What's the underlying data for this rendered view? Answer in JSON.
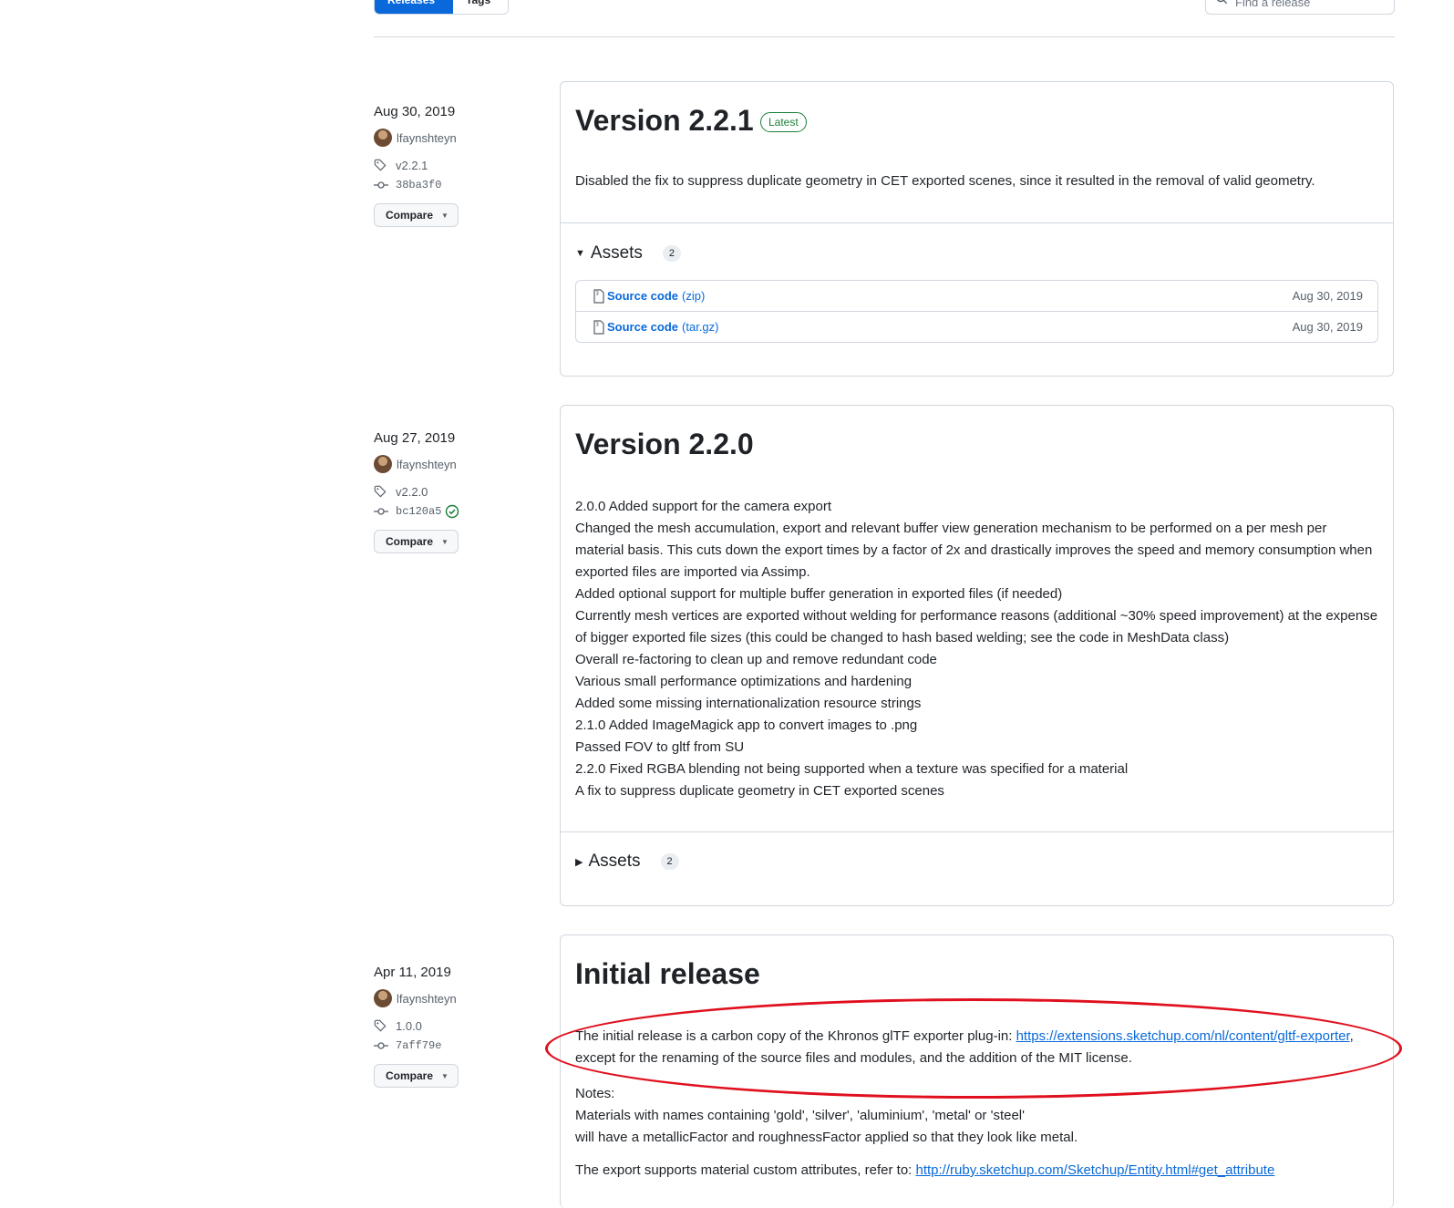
{
  "tabs": {
    "releases": "Releases",
    "tags": "Tags"
  },
  "search": {
    "placeholder": "Find a release"
  },
  "releases": [
    {
      "date": "Aug 30, 2019",
      "author": "lfaynshteyn",
      "tag": "v2.2.1",
      "commit": "38ba3f0",
      "compare_label": "Compare",
      "title": "Version 2.2.1",
      "badge": "Latest",
      "body": [
        "Disabled the fix to suppress duplicate geometry in CET exported scenes, since it resulted in the removal of valid geometry."
      ],
      "assets_label": "Assets",
      "assets_count": "2",
      "assets": [
        {
          "name": "Source code",
          "format": "(zip)",
          "date": "Aug 30, 2019"
        },
        {
          "name": "Source code",
          "format": "(tar.gz)",
          "date": "Aug 30, 2019"
        }
      ]
    },
    {
      "date": "Aug 27, 2019",
      "author": "lfaynshteyn",
      "tag": "v2.2.0",
      "commit": "bc120a5",
      "compare_label": "Compare",
      "title": "Version 2.2.0",
      "body": [
        "2.0.0 Added support for the camera export",
        "Changed the mesh accumulation, export and relevant buffer view generation mechanism to be performed on a per mesh per material basis. This cuts down the export times by a factor of 2x and drastically improves the speed and memory consumption when exported files are imported via Assimp.",
        "Added optional support for multiple buffer generation in exported files (if needed)",
        "Currently mesh vertices are exported without welding for performance reasons (additional ~30% speed improvement) at the expense of bigger exported file sizes (this could be changed to hash based welding; see the code in MeshData class)",
        "Overall re-factoring to clean up and remove redundant code",
        "Various small performance optimizations and hardening",
        "Added some missing internationalization resource strings",
        "2.1.0 Added ImageMagick app to convert images to .png",
        "Passed FOV to gltf from SU",
        "2.2.0 Fixed RGBA blending not being supported when a texture was specified for a material",
        "A fix to suppress duplicate geometry in CET exported scenes"
      ],
      "assets_label": "Assets",
      "assets_count": "2"
    },
    {
      "date": "Apr 11, 2019",
      "author": "lfaynshteyn",
      "tag": "1.0.0",
      "commit": "7aff79e",
      "compare_label": "Compare",
      "title": "Initial release",
      "intro": "The initial release is a carbon copy of the Khronos glTF exporter plug-in: ",
      "intro_link": "https://extensions.sketchup.com/nl/content/gltf-exporter",
      "intro_rest": ", except for the renaming of the source files and modules, and the addition of the MIT license.",
      "notes": [
        "Notes:",
        "Materials with names containing 'gold', 'silver', 'aluminium', 'metal' or 'steel'",
        "will have a metallicFactor and roughnessFactor applied so that they look like metal."
      ],
      "extra": "The export supports material custom attributes, refer to: ",
      "extra_link": "http://ruby.sketchup.com/Sketchup/Entity.html#get_attribute"
    }
  ]
}
